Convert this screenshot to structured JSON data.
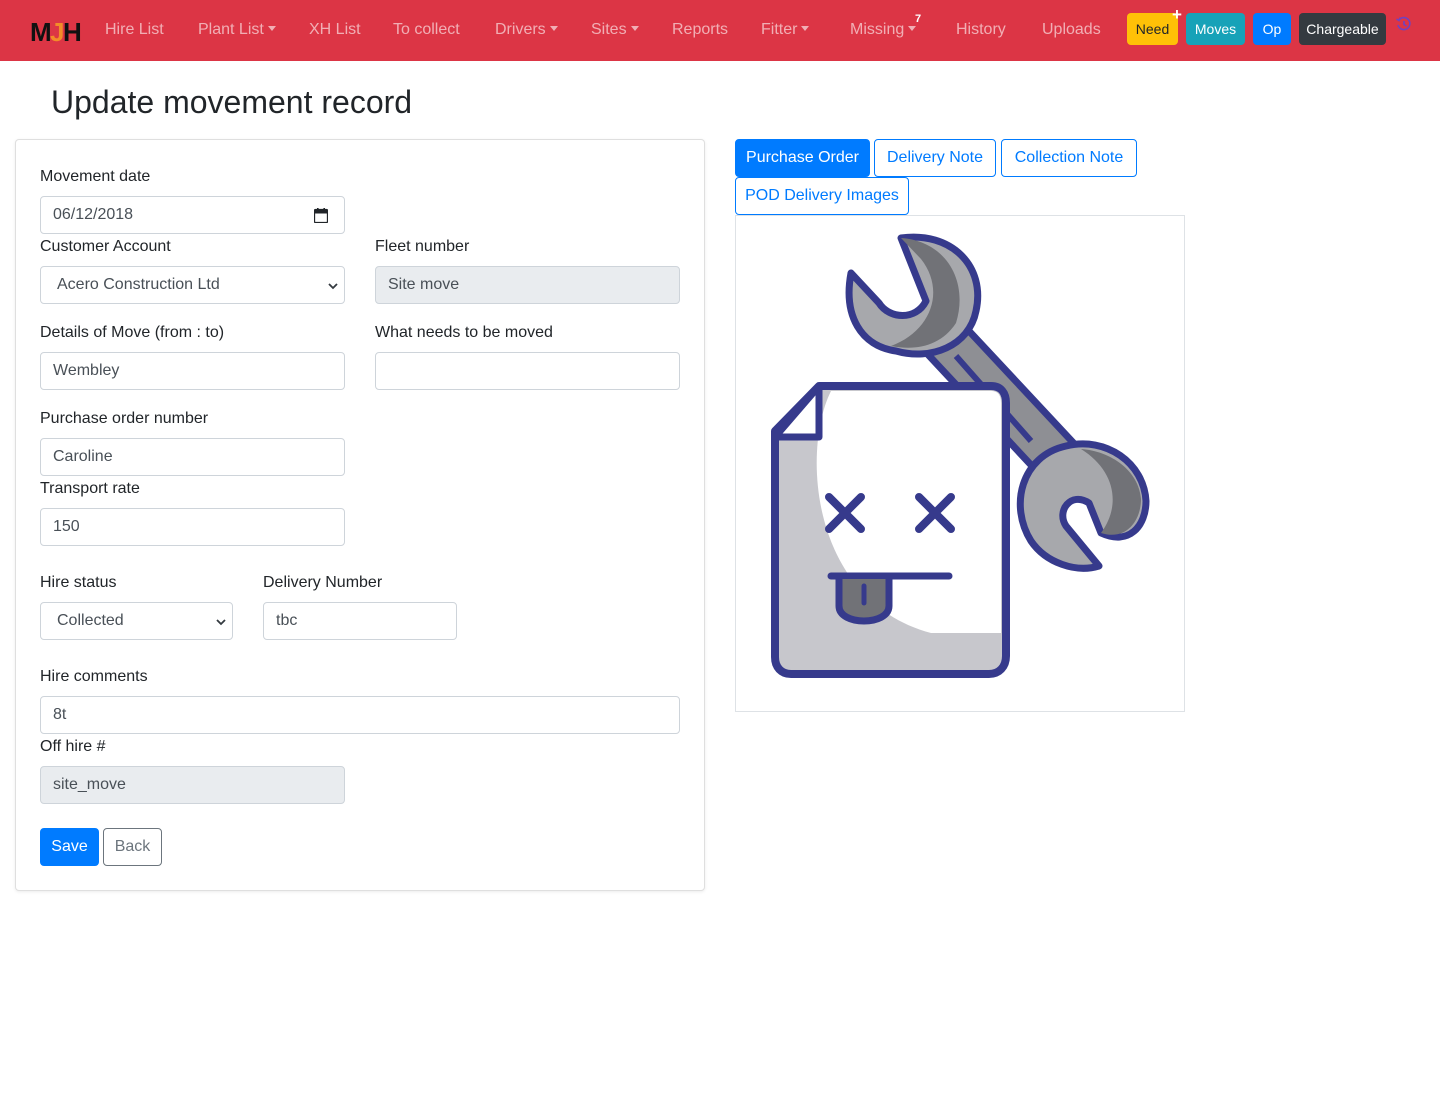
{
  "nav": {
    "brand": "MJH",
    "links": [
      {
        "label": "Hire List"
      },
      {
        "label": "Plant List"
      },
      {
        "label": "XH List"
      },
      {
        "label": "To collect"
      },
      {
        "label": "Drivers"
      },
      {
        "label": "Sites"
      },
      {
        "label": "Reports"
      },
      {
        "label": "Fitter"
      },
      {
        "label": "Missing"
      },
      {
        "label": "History"
      },
      {
        "label": "Uploads"
      }
    ],
    "missing_count": "7",
    "plus_icon": "+",
    "buttons": [
      {
        "label": "Need",
        "color": "#ffc107"
      },
      {
        "label": "Moves",
        "color": "#17a2b8"
      },
      {
        "label": "Op",
        "color": "#007bff"
      },
      {
        "label": "Chargeable",
        "color": "#343a40"
      }
    ],
    "color": "#dc3545"
  },
  "page": {
    "title": "Update movement record"
  },
  "form": {
    "movement_date": {
      "label": "Movement date",
      "value": "06/12/2018"
    },
    "customer_account": {
      "label": "Customer Account",
      "value": "Acero Construction Ltd"
    },
    "fleet_number": {
      "label": "Fleet number",
      "value": "Site move"
    },
    "details_of_move": {
      "label": "Details of Move (from : to)",
      "value": "Wembley"
    },
    "what_needs_moving": {
      "label": "What needs to be moved",
      "value": ""
    },
    "purchase_order": {
      "label": "Purchase order number",
      "value": "Caroline"
    },
    "transport_rate": {
      "label": "Transport rate",
      "value": "150"
    },
    "hire_status": {
      "label": "Hire status",
      "value": "Collected"
    },
    "delivery_number": {
      "label": "Delivery Number",
      "value": "tbc"
    },
    "hire_comments": {
      "label": "Hire comments",
      "value": "8t"
    },
    "off_hire": {
      "label": "Off hire #",
      "value": "site_move"
    },
    "save_label": "Save",
    "back_label": "Back"
  },
  "documents": {
    "tabs": [
      {
        "label": "Purchase Order",
        "active": true
      },
      {
        "label": "Delivery Note",
        "active": false
      },
      {
        "label": "Collection Note",
        "active": false
      },
      {
        "label": "POD Delivery Images",
        "active": false
      }
    ],
    "preview_icon": "broken-document-wrench-icon"
  }
}
